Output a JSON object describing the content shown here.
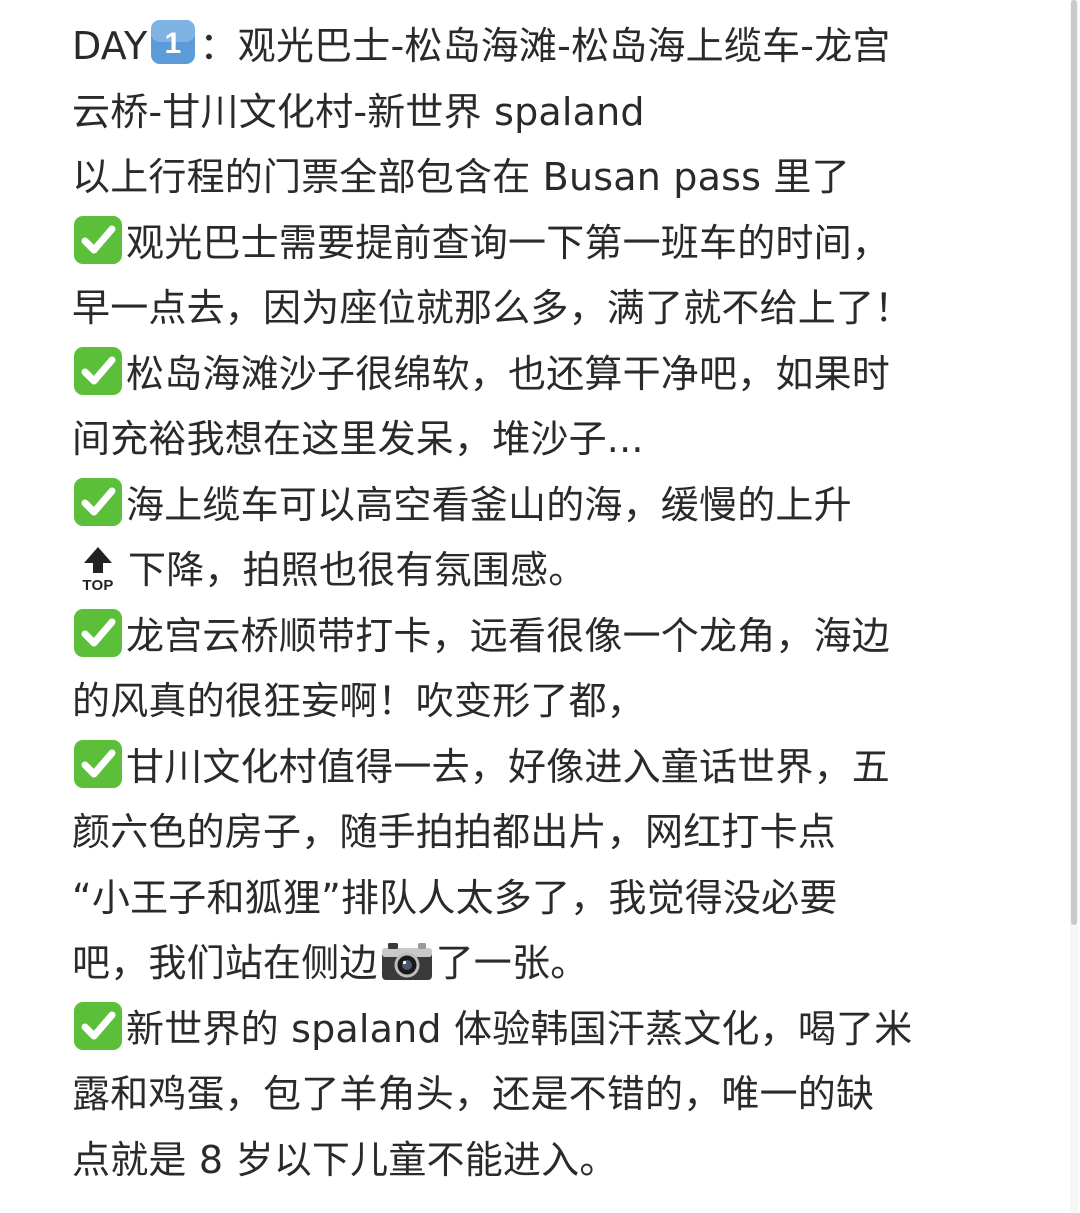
{
  "lines": [
    {
      "a": "DAY",
      "b": "：观光巴士-松岛海滩-松岛海上缆车-龙宫"
    },
    {
      "text": "云桥-甘川文化村-新世界 spaland"
    },
    {
      "text": "以上行程的门票全部包含在 Busan pass 里了"
    },
    {
      "text": "观光巴士需要提前查询一下第一班车的时间，"
    },
    {
      "text": "早一点去，因为座位就那么多，满了就不给上了！"
    },
    {
      "text": "松岛海滩沙子很绵软，也还算干净吧，如果时"
    },
    {
      "text": "间充裕我想在这里发呆，堆沙子..."
    },
    {
      "text": "海上缆车可以高空看釜山的海，缓慢的上升"
    },
    {
      "text": "下降，拍照也很有氛围感。"
    },
    {
      "text": "龙宫云桥顺带打卡，远看很像一个龙角，海边"
    },
    {
      "text": "的风真的很狂妄啊！吹变形了都，"
    },
    {
      "text": "甘川文化村值得一去，好像进入童话世界，五"
    },
    {
      "text": "颜六色的房子，随手拍拍都出片，网红打卡点"
    },
    {
      "text": "“小王子和狐狸”排队人太多了，我觉得没必要"
    },
    {
      "a": "吧，我们站在侧边",
      "b": "了一张。"
    },
    {
      "text": "新世界的 spaland 体验韩国汗蒸文化，喝了米"
    },
    {
      "text": "露和鸡蛋，包了羊角头，还是不错的，唯一的缺"
    },
    {
      "text": "点就是 8 岁以下儿童不能进入。"
    }
  ],
  "icons": {
    "number_badge": "1",
    "top_label": "TOP",
    "check_color": "#5bbf3a",
    "badge_color": "#5b9bd8"
  }
}
